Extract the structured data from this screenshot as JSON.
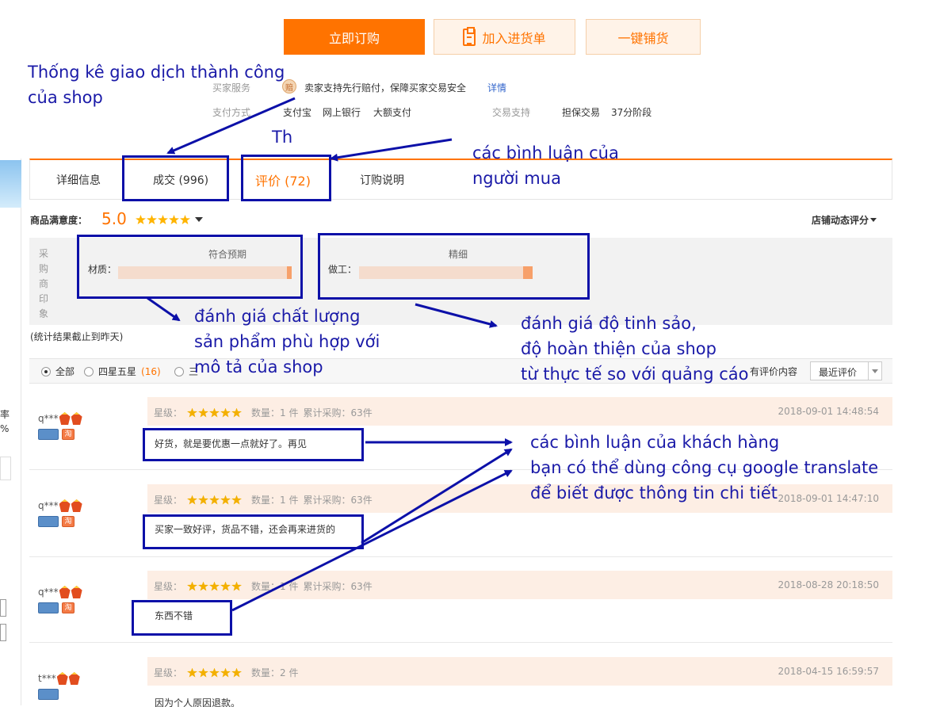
{
  "actions": {
    "buy_now": "立即订购",
    "add_to_list": "加入进货单",
    "one_click": "一键铺货"
  },
  "service": {
    "buyer_service_label": "买家服务",
    "shield_glyph": "赔",
    "buyer_service_text": "卖家支持先行赔付，保障买家交易安全",
    "details_link": "详情",
    "payment_label": "支付方式",
    "payment_methods": [
      "支付宝",
      "网上银行",
      "大额支付"
    ],
    "trade_support_label": "交易支持",
    "trade_support": [
      "担保交易",
      "37分阶段"
    ]
  },
  "tabs": [
    {
      "label": "详细信息",
      "active": false
    },
    {
      "label": "成交 (996)",
      "active": false
    },
    {
      "label": "评价 (72)",
      "active": true
    },
    {
      "label": "订购说明",
      "active": false
    }
  ],
  "satisfaction": {
    "label": "商品满意度：",
    "score": "5.0",
    "stars": 5,
    "shop_rating_label": "店铺动态评分"
  },
  "impression": {
    "side_label": [
      "采",
      "购",
      "商",
      "印",
      "象"
    ],
    "material_label": "材质：",
    "material_caption": "符合预期",
    "material_fill": 1.0,
    "work_label": "做工：",
    "work_caption": "精细",
    "work_fill": 1.0,
    "footnote": "(统计结果截止到昨天)"
  },
  "filter": {
    "all": "全部",
    "four_five": "四星五星",
    "four_five_count": "(16)",
    "three": "三",
    "has_content": "有评价内容",
    "sort_selected": "最近评价"
  },
  "reviews": [
    {
      "user": "q***",
      "stars_label": "星级：",
      "qty": "数量：1 件",
      "total": "累计采购：63件",
      "date": "2018-09-01 14:48:54",
      "text": "好货，就是要优惠一点就好了。再见"
    },
    {
      "user": "q***",
      "stars_label": "星级：",
      "qty": "数量：1 件",
      "total": "累计采购：63件",
      "date": "2018-09-01 14:47:10",
      "text": "买家一致好评，货品不错，还会再来进货的"
    },
    {
      "user": "q***",
      "stars_label": "星级：",
      "qty": "数量：1 件",
      "total": "累计采购：63件",
      "date": "2018-08-28 20:18:50",
      "text": "东西不错"
    },
    {
      "user": "t***",
      "stars_label": "星级：",
      "qty": "数量：2 件",
      "total": "",
      "date": "2018-04-15 16:59:57",
      "text": "因为个人原因退款。"
    }
  ],
  "badge_glyph": "淘",
  "sidebar_fragments": [
    "率",
    "%"
  ],
  "annotations": {
    "stats": [
      "Thống kê giao dịch thành công",
      "của shop"
    ],
    "th": "Th",
    "comments": [
      "các bình luận của",
      "người mua"
    ],
    "quality": [
      "đánh giá chất lượng",
      "sản phẩm phù hợp với",
      "mô tả của shop"
    ],
    "finish": [
      "đánh giá độ tinh sảo,",
      "độ hoàn thiện của shop",
      "từ thực tế so với quảng cáo"
    ],
    "customer": [
      "các bình luận của khách hàng",
      "bạn có thể dùng công cụ google translate",
      "để biết được thông tin chi tiết"
    ]
  },
  "colors": {
    "accent": "#ff7300",
    "annotation": "#0c10a8",
    "review_head_bg": "#fdeee4"
  }
}
